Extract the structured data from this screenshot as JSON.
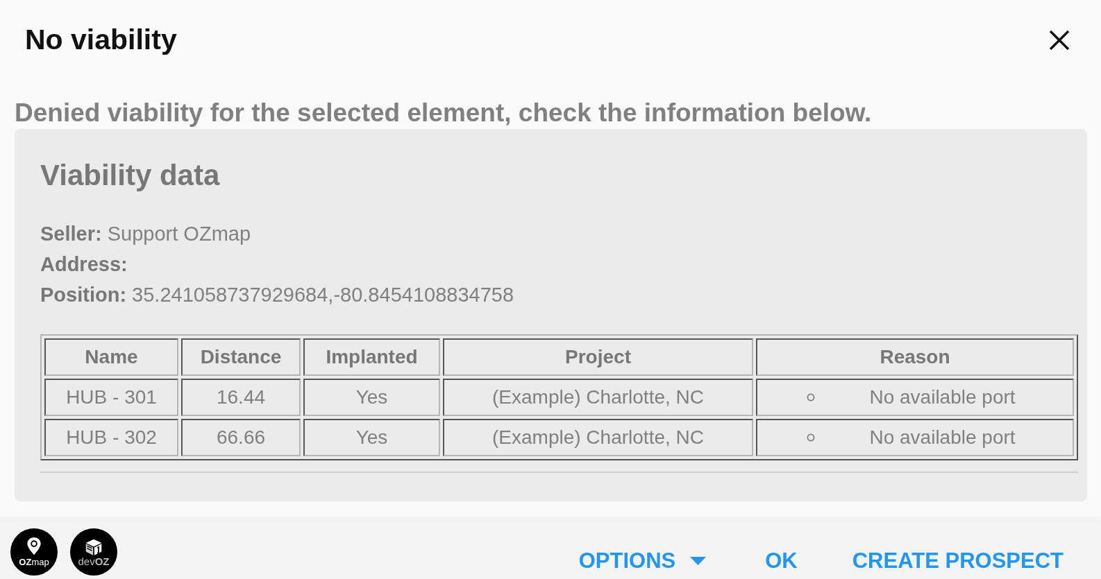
{
  "dialog": {
    "title": "No viability",
    "message": "Denied viability for the selected element, check the information below."
  },
  "viability_data": {
    "title": "Viability data",
    "fields": [
      {
        "label": "Seller:",
        "value": "Support OZmap"
      },
      {
        "label": "Address:"
      },
      {
        "label": "Position:",
        "value": "35.241058737929684,-80.8454108834758"
      }
    ],
    "table": {
      "columns": [
        "Name",
        "Distance",
        "Implanted",
        "Project",
        "Reason"
      ],
      "rows": [
        {
          "cells": [
            "HUB - 301",
            "16.44",
            "Yes",
            "(Example) Charlotte, NC"
          ],
          "reasons": [
            "No available port"
          ]
        },
        {
          "cells": [
            "HUB - 302",
            "66.66",
            "Yes",
            "(Example) Charlotte, NC"
          ],
          "reasons": [
            "No available port"
          ]
        }
      ]
    }
  },
  "footer": {
    "logos": [
      {
        "kind": "pin",
        "text": "**OZ**map"
      },
      {
        "kind": "cube",
        "text": "dev**OZ**"
      }
    ],
    "buttons": [
      {
        "label": "OPTIONS",
        "kind": "dropdown"
      },
      {
        "label": "OK",
        "kind": "plain"
      },
      {
        "label": "CREATE PROSPECT",
        "kind": "plain"
      }
    ]
  }
}
